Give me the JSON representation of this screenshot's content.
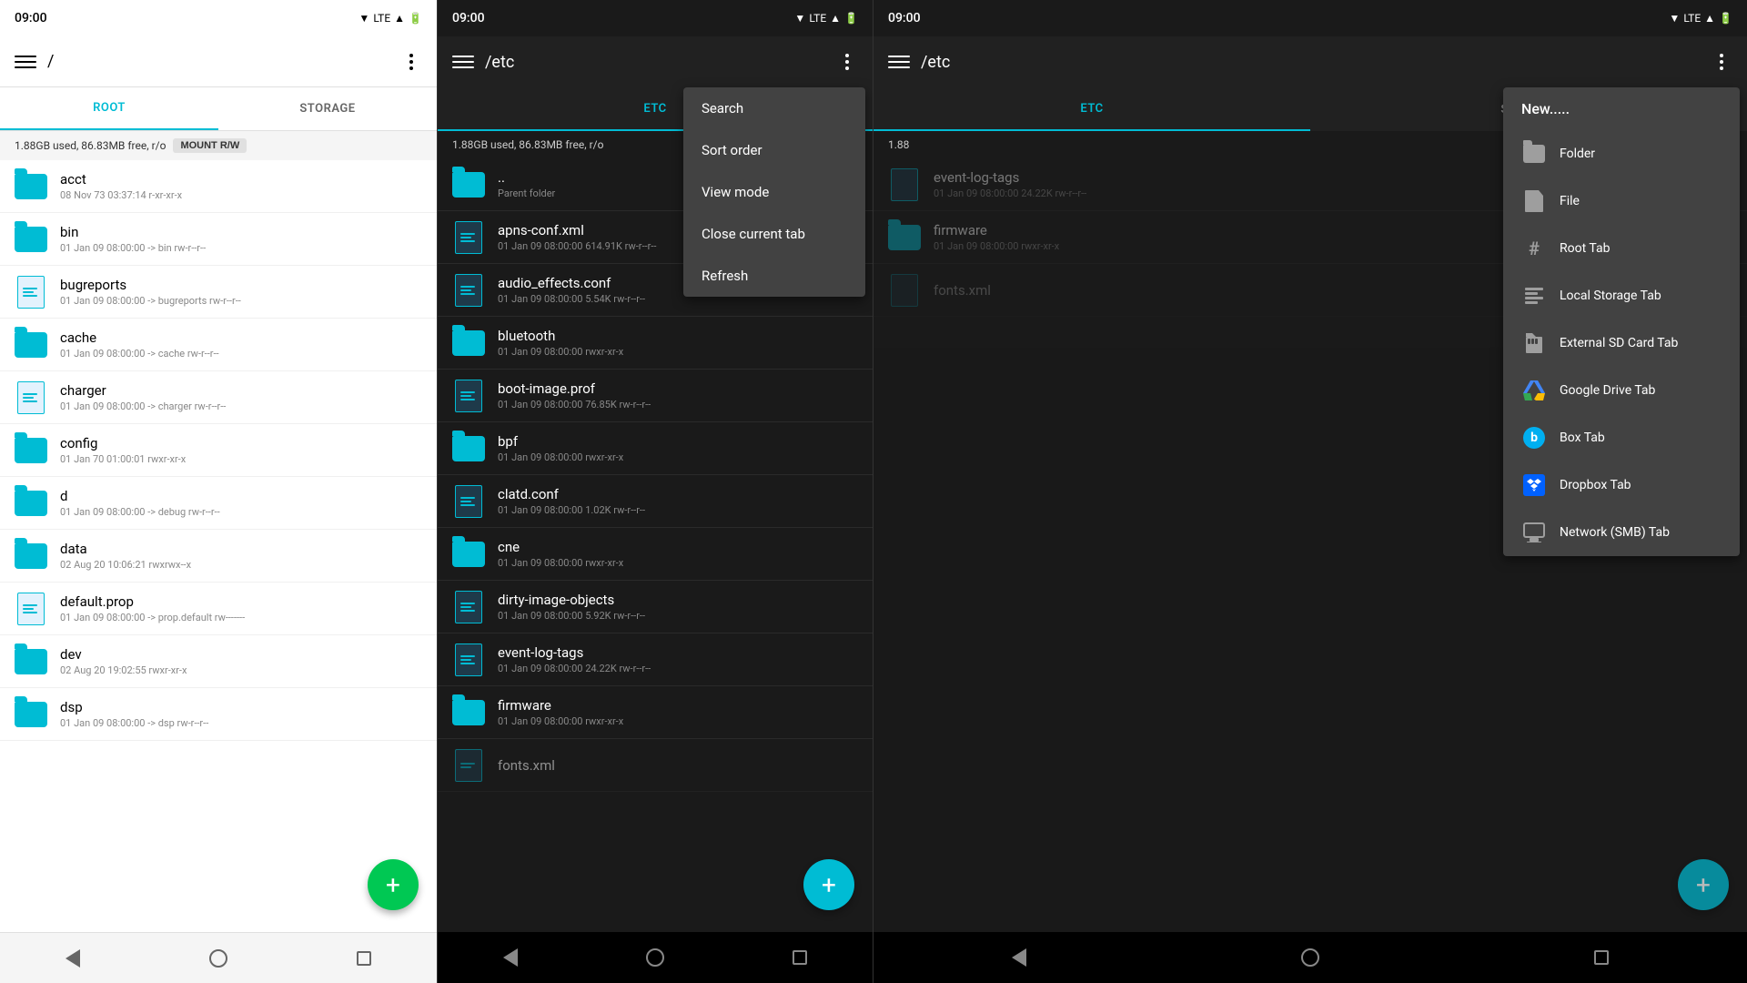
{
  "panels": [
    {
      "id": "panel1",
      "theme": "light",
      "statusBar": {
        "time": "09:00",
        "icons": "▼ LTE▲ 🔋"
      },
      "toolbar": {
        "menuLabel": "menu",
        "title": "/",
        "moreLabel": "more"
      },
      "tabs": [
        {
          "label": "ROOT",
          "active": true
        },
        {
          "label": "STORAGE",
          "active": false
        }
      ],
      "storageInfo": "1.88GB used, 86.83MB free, r/o",
      "mountBtn": "MOUNT R/W",
      "files": [
        {
          "type": "folder",
          "name": "acct",
          "meta": "08 Nov 73 03:37:14  r-xr-xr-x"
        },
        {
          "type": "folder",
          "name": "bin",
          "meta": "01 Jan 09 08:00:00  -> bin  rw-r--r--"
        },
        {
          "type": "file",
          "name": "bugreports",
          "meta": "01 Jan 09 08:00:00  -> bugreports  rw-r--r--"
        },
        {
          "type": "folder",
          "name": "cache",
          "meta": "01 Jan 09 08:00:00  -> cache  rw-r--r--"
        },
        {
          "type": "file",
          "name": "charger",
          "meta": "01 Jan 09 08:00:00  -> charger  rw-r--r--"
        },
        {
          "type": "folder",
          "name": "config",
          "meta": "01 Jan 70 01:00:01  rwxr-xr-x"
        },
        {
          "type": "folder",
          "name": "d",
          "meta": "01 Jan 09 08:00:00  -> debug  rw-r--r--"
        },
        {
          "type": "folder",
          "name": "data",
          "meta": "02 Aug 20 10:06:21  rwxrwx--x"
        },
        {
          "type": "file",
          "name": "default.prop",
          "meta": "01 Jan 09 08:00:00  -> prop.default  rw-------"
        },
        {
          "type": "folder",
          "name": "dev",
          "meta": "02 Aug 20 19:02:55  rwxr-xr-x"
        },
        {
          "type": "folder",
          "name": "dsp",
          "meta": "01 Jan 09 08:00:00  -> dsp  rw-r--r--"
        }
      ],
      "fab": "+"
    },
    {
      "id": "panel2",
      "theme": "dark",
      "statusBar": {
        "time": "09:00",
        "icons": "▼ LTE▲ 🔋"
      },
      "toolbar": {
        "menuLabel": "menu",
        "title": "/etc",
        "moreLabel": "more"
      },
      "tabs": [
        {
          "label": "ETC",
          "active": true
        },
        {
          "label": "",
          "active": false
        }
      ],
      "storageInfo": "1.88GB used, 86.83MB free, r/o",
      "files": [
        {
          "type": "folder",
          "name": "..",
          "meta": "Parent folder"
        },
        {
          "type": "file",
          "name": "apns-conf.xml",
          "meta": "01 Jan 09 08:00:00  614.91K  rw-r--r--"
        },
        {
          "type": "file",
          "name": "audio_effects.conf",
          "meta": "01 Jan 09 08:00:00  5.54K  rw-r--r--"
        },
        {
          "type": "folder",
          "name": "bluetooth",
          "meta": "01 Jan 09 08:00:00  rwxr-xr-x"
        },
        {
          "type": "file",
          "name": "boot-image.prof",
          "meta": "01 Jan 09 08:00:00  76.85K  rw-r--r--"
        },
        {
          "type": "folder",
          "name": "bpf",
          "meta": "01 Jan 09 08:00:00  rwxr-xr-x"
        },
        {
          "type": "file",
          "name": "clatd.conf",
          "meta": "01 Jan 09 08:00:00  1.02K  rw-r--r--"
        },
        {
          "type": "folder",
          "name": "cne",
          "meta": "01 Jan 09 08:00:00  rwxr-xr-x"
        },
        {
          "type": "file",
          "name": "dirty-image-objects",
          "meta": "01 Jan 09 08:00:00  5.92K  rw-r--r--"
        },
        {
          "type": "file",
          "name": "event-log-tags",
          "meta": "01 Jan 09 08:00:00  24.22K  rw-r--r--"
        },
        {
          "type": "folder",
          "name": "firmware",
          "meta": "01 Jan 09 08:00:00  rwxr-xr-x"
        },
        {
          "type": "file",
          "name": "fonts.xml",
          "meta": ""
        }
      ],
      "fab": "+",
      "dropdown": {
        "visible": true,
        "items": [
          {
            "label": "Search"
          },
          {
            "label": "Sort order"
          },
          {
            "label": "View mode"
          },
          {
            "label": "Close current tab"
          },
          {
            "label": "Refresh"
          }
        ]
      }
    },
    {
      "id": "panel3",
      "theme": "dark",
      "statusBar": {
        "time": "09:00",
        "icons": "▼ LTE▲ 🔋"
      },
      "toolbar": {
        "menuLabel": "menu",
        "title": "/etc",
        "moreLabel": "more"
      },
      "tabs": [
        {
          "label": "ETC",
          "active": true
        },
        {
          "label": "STORAGE",
          "active": false
        }
      ],
      "storageInfo": "1.88",
      "files": [
        {
          "type": "file",
          "name": "event-log-tags",
          "meta": "01 Jan 09 08:00:00  24.22K  rw-r--r--"
        },
        {
          "type": "folder",
          "name": "firmware",
          "meta": "01 Jan 09 08:00:00  rwxr-xr-x"
        },
        {
          "type": "file",
          "name": "fonts.xml",
          "meta": ""
        }
      ],
      "fab": "+",
      "newMenu": {
        "visible": true,
        "header": "New.....",
        "items": [
          {
            "label": "Folder",
            "iconType": "folder-gray"
          },
          {
            "label": "File",
            "iconType": "file-gray"
          },
          {
            "label": "Root Tab",
            "iconType": "hash"
          },
          {
            "label": "Local Storage Tab",
            "iconType": "lines"
          },
          {
            "label": "External SD Card Tab",
            "iconType": "sd"
          },
          {
            "label": "Google Drive Tab",
            "iconType": "gdrive"
          },
          {
            "label": "Box Tab",
            "iconType": "box"
          },
          {
            "label": "Dropbox Tab",
            "iconType": "dropbox"
          },
          {
            "label": "Network (SMB) Tab",
            "iconType": "network"
          }
        ]
      }
    }
  ]
}
